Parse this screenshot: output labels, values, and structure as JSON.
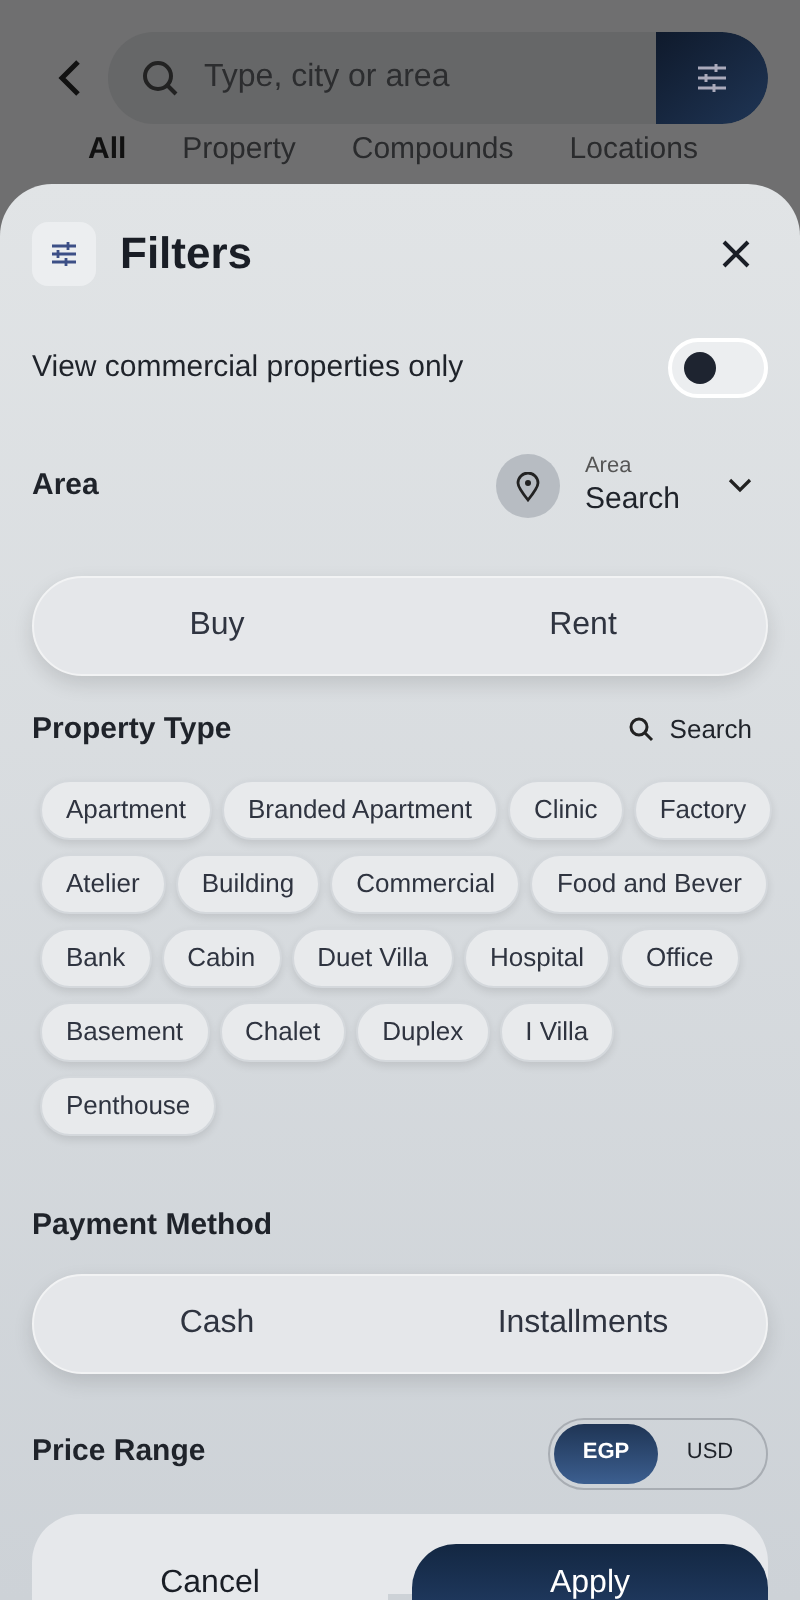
{
  "search": {
    "placeholder": "Type, city or area"
  },
  "tabs": [
    {
      "label": "All",
      "selected": true
    },
    {
      "label": "Property",
      "selected": false
    },
    {
      "label": "Compounds",
      "selected": false
    },
    {
      "label": "Locations",
      "selected": false
    }
  ],
  "filters": {
    "title": "Filters",
    "commercial_only": {
      "label": "View commercial properties only",
      "on": false
    },
    "area": {
      "label": "Area",
      "caption": "Area",
      "value": "Search"
    },
    "listing_type": [
      {
        "label": "Buy",
        "selected": false
      },
      {
        "label": "Rent",
        "selected": false
      }
    ],
    "property_type": {
      "label": "Property Type",
      "search": "Search",
      "chips": [
        {
          "label": "Apartment",
          "selected": false
        },
        {
          "label": "Branded Apartment",
          "selected": false
        },
        {
          "label": "Clinic",
          "selected": false
        },
        {
          "label": "Factory",
          "selected": false
        },
        {
          "label": "Atelier",
          "selected": false
        },
        {
          "label": "Building",
          "selected": false
        },
        {
          "label": "Commercial",
          "selected": false
        },
        {
          "label": "Food and Bever",
          "selected": false
        },
        {
          "label": "Bank",
          "selected": false
        },
        {
          "label": "Cabin",
          "selected": false
        },
        {
          "label": "Duet Villa",
          "selected": false
        },
        {
          "label": "Hospital",
          "selected": false
        },
        {
          "label": "Office",
          "selected": false
        },
        {
          "label": "Basement",
          "selected": false
        },
        {
          "label": "Chalet",
          "selected": false
        },
        {
          "label": "Duplex",
          "selected": false
        },
        {
          "label": "I Villa",
          "selected": false
        },
        {
          "label": "Penthouse",
          "selected": false
        }
      ]
    },
    "payment_method": {
      "label": "Payment Method",
      "options": [
        {
          "label": "Cash",
          "selected": false
        },
        {
          "label": "Installments",
          "selected": false
        }
      ]
    },
    "price_range": {
      "label": "Price Range",
      "currencies": [
        {
          "label": "EGP",
          "selected": true
        },
        {
          "label": "USD",
          "selected": false
        }
      ]
    }
  },
  "buttons": [
    {
      "label": "Cancel",
      "kind": "secondary"
    },
    {
      "label": "Apply",
      "kind": "primary"
    }
  ]
}
